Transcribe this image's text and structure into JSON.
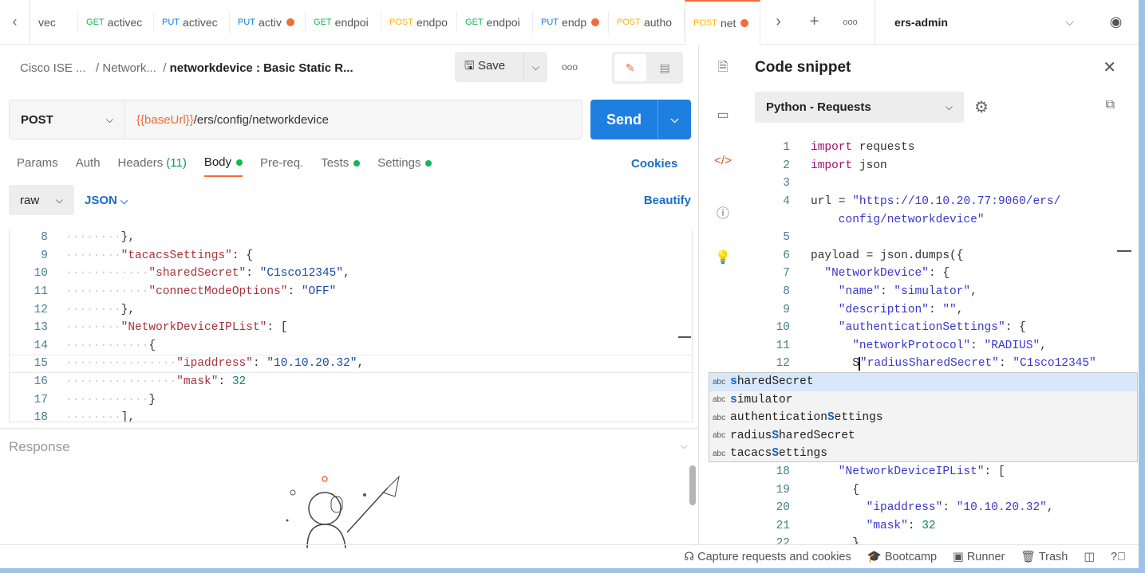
{
  "tabs": [
    {
      "method": "",
      "name": "vec",
      "color": "#888",
      "dot": false
    },
    {
      "method": "GET",
      "name": "activec",
      "color": "#0cbb52",
      "dot": false
    },
    {
      "method": "PUT",
      "name": "activec",
      "color": "#097bed",
      "dot": false
    },
    {
      "method": "PUT",
      "name": "activ",
      "color": "#097bed",
      "dot": true
    },
    {
      "method": "GET",
      "name": "endpoi",
      "color": "#0cbb52",
      "dot": false
    },
    {
      "method": "POST",
      "name": "endpo",
      "color": "#ffb400",
      "dot": false
    },
    {
      "method": "GET",
      "name": "endpoi",
      "color": "#0cbb52",
      "dot": false
    },
    {
      "method": "PUT",
      "name": "endp",
      "color": "#097bed",
      "dot": true
    },
    {
      "method": "POST",
      "name": "autho",
      "color": "#ffb400",
      "dot": false
    },
    {
      "method": "POST",
      "name": "net",
      "color": "#ffb400",
      "dot": true,
      "active": true
    }
  ],
  "environment": "ers-admin",
  "breadcrumb": {
    "root": "Cisco ISE ...",
    "folder": "Network...",
    "current": "networkdevice : Basic Static R..."
  },
  "toolbar": {
    "save": "Save"
  },
  "request": {
    "method": "POST",
    "url_var": "{{baseUrl}}",
    "url_path": "/ers/config/networkdevice",
    "send": "Send"
  },
  "req_tabs": [
    {
      "label": "Params"
    },
    {
      "label": "Auth"
    },
    {
      "label": "Headers",
      "count": "(11)"
    },
    {
      "label": "Body",
      "dot": true,
      "active": true
    },
    {
      "label": "Pre-req."
    },
    {
      "label": "Tests",
      "dot": true
    },
    {
      "label": "Settings",
      "dot": true
    }
  ],
  "cookies": "Cookies",
  "body": {
    "type": "raw",
    "format": "JSON",
    "beautify": "Beautify"
  },
  "body_lines": [
    {
      "n": "8",
      "ind": "········",
      "t": [
        [
          "},",
          "p"
        ]
      ]
    },
    {
      "n": "9",
      "ind": "········",
      "t": [
        [
          "\"tacacsSettings\"",
          "k"
        ],
        [
          ": {",
          "p"
        ]
      ]
    },
    {
      "n": "10",
      "ind": "············",
      "t": [
        [
          "\"sharedSecret\"",
          "k"
        ],
        [
          ": ",
          "p"
        ],
        [
          "\"C1sco12345\"",
          "s"
        ],
        [
          ",",
          "p"
        ]
      ]
    },
    {
      "n": "11",
      "ind": "············",
      "t": [
        [
          "\"connectModeOptions\"",
          "k"
        ],
        [
          ": ",
          "p"
        ],
        [
          "\"OFF\"",
          "s"
        ]
      ]
    },
    {
      "n": "12",
      "ind": "········",
      "t": [
        [
          "},",
          "p"
        ]
      ]
    },
    {
      "n": "13",
      "ind": "········",
      "t": [
        [
          "\"NetworkDeviceIPList\"",
          "k"
        ],
        [
          ": [",
          "p"
        ]
      ]
    },
    {
      "n": "14",
      "ind": "············",
      "t": [
        [
          "{",
          "p"
        ]
      ]
    },
    {
      "n": "15",
      "ind": "················",
      "t": [
        [
          "\"ipaddress\"",
          "k"
        ],
        [
          ": ",
          "p"
        ],
        [
          "\"10.10.20.32\"",
          "s"
        ],
        [
          ",",
          "p"
        ]
      ],
      "hl": true
    },
    {
      "n": "16",
      "ind": "················",
      "t": [
        [
          "\"mask\"",
          "k"
        ],
        [
          ": ",
          "p"
        ],
        [
          "32",
          "n"
        ]
      ]
    },
    {
      "n": "17",
      "ind": "············",
      "t": [
        [
          "}",
          "p"
        ]
      ]
    },
    {
      "n": "18",
      "ind": "········",
      "t": [
        [
          "],",
          "p"
        ]
      ]
    }
  ],
  "response": {
    "title": "Response"
  },
  "snippet": {
    "title": "Code snippet",
    "language": "Python - Requests"
  },
  "snippet_lines": [
    {
      "n": "1",
      "t": [
        [
          "import",
          "kw"
        ],
        [
          " requests",
          "pv"
        ]
      ]
    },
    {
      "n": "2",
      "t": [
        [
          "import",
          "kw"
        ],
        [
          " json",
          "pv"
        ]
      ]
    },
    {
      "n": "3",
      "t": []
    },
    {
      "n": "4",
      "t": [
        [
          "url = ",
          "pv"
        ],
        [
          "\"https://10.10.20.77:9060/ers/",
          "ps"
        ]
      ]
    },
    {
      "n": "",
      "t": [
        [
          "    config/networkdevice\"",
          "ps"
        ]
      ]
    },
    {
      "n": "5",
      "t": []
    },
    {
      "n": "6",
      "t": [
        [
          "payload = json.dumps({",
          "pv"
        ]
      ]
    },
    {
      "n": "7",
      "t": [
        [
          "  \"NetworkDevice\"",
          "ps"
        ],
        [
          ": {",
          "pv"
        ]
      ]
    },
    {
      "n": "8",
      "t": [
        [
          "    \"name\"",
          "ps"
        ],
        [
          ": ",
          "pv"
        ],
        [
          "\"simulator\"",
          "ps"
        ],
        [
          ",",
          "pv"
        ]
      ]
    },
    {
      "n": "9",
      "t": [
        [
          "    \"description\"",
          "ps"
        ],
        [
          ": ",
          "pv"
        ],
        [
          "\"\"",
          "ps"
        ],
        [
          ",",
          "pv"
        ]
      ]
    },
    {
      "n": "10",
      "t": [
        [
          "    \"authenticationSettings\"",
          "ps"
        ],
        [
          ": {",
          "pv"
        ]
      ]
    },
    {
      "n": "11",
      "t": [
        [
          "      \"networkProtocol\"",
          "ps"
        ],
        [
          ": ",
          "pv"
        ],
        [
          "\"RADIUS\"",
          "ps"
        ],
        [
          ",",
          "pv"
        ]
      ]
    },
    {
      "n": "12",
      "t": [
        [
          "      S",
          "pv"
        ],
        [
          "\"radiusSharedSecret\"",
          "ps"
        ],
        [
          ": ",
          "pv"
        ],
        [
          "\"C1sco12345\"",
          "ps"
        ]
      ]
    },
    {
      "n": "",
      "t": []
    },
    {
      "n": "",
      "t": []
    },
    {
      "n": "",
      "t": []
    },
    {
      "n": "",
      "t": []
    },
    {
      "n": "",
      "t": []
    },
    {
      "n": "18",
      "t": [
        [
          "    \"NetworkDeviceIPList\"",
          "ps"
        ],
        [
          ": [",
          "pv"
        ]
      ]
    },
    {
      "n": "19",
      "t": [
        [
          "      {",
          "pv"
        ]
      ]
    },
    {
      "n": "20",
      "t": [
        [
          "        \"ipaddress\"",
          "ps"
        ],
        [
          ": ",
          "pv"
        ],
        [
          "\"10.10.20.32\"",
          "ps"
        ],
        [
          ",",
          "pv"
        ]
      ]
    },
    {
      "n": "21",
      "t": [
        [
          "        \"mask\"",
          "ps"
        ],
        [
          ": ",
          "pv"
        ],
        [
          "32",
          "pn"
        ]
      ]
    },
    {
      "n": "22",
      "t": [
        [
          "      }",
          "pv"
        ]
      ]
    }
  ],
  "autocomplete": [
    {
      "badge": "abc",
      "pre": "",
      "match": "s",
      "post": "haredSecret",
      "selected": true
    },
    {
      "badge": "abc",
      "pre": "",
      "match": "s",
      "post": "imulator"
    },
    {
      "badge": "abc",
      "pre": "authentication",
      "match": "S",
      "post": "ettings"
    },
    {
      "badge": "abc",
      "pre": "radius",
      "match": "S",
      "post": "haredSecret"
    },
    {
      "badge": "abc",
      "pre": "tacacs",
      "match": "S",
      "post": "ettings"
    }
  ],
  "status": {
    "capture": "Capture requests and cookies",
    "bootcamp": "Bootcamp",
    "runner": "Runner",
    "trash": "Trash"
  }
}
